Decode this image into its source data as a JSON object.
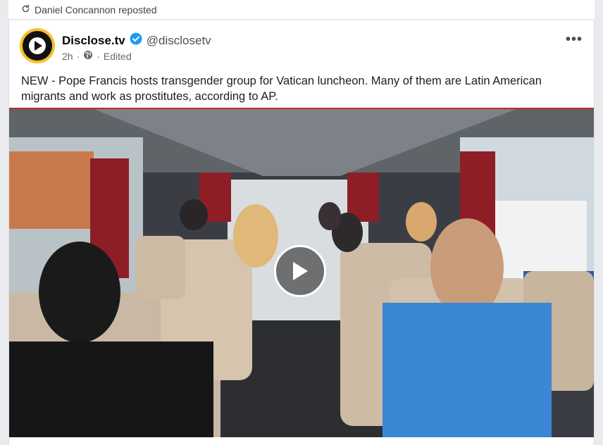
{
  "repost": {
    "text": "Daniel Concannon reposted",
    "icon": "repost-icon"
  },
  "post": {
    "author_name": "Disclose.tv",
    "verified": true,
    "handle": "@disclosetv",
    "time": "2h",
    "separator": "·",
    "edited": "Edited",
    "privacy_icon": "globe-icon",
    "more_label": "•••",
    "text": "NEW - Pope Francis hosts transgender group for Vatican luncheon. Many of them are Latin American migrants and work as prostitutes, according to AP."
  },
  "video": {
    "play_icon": "play-icon"
  },
  "colors": {
    "verified_badge": "#1d9bf0",
    "avatar_ring": "#f6c026",
    "video_border": "#c0262d"
  }
}
